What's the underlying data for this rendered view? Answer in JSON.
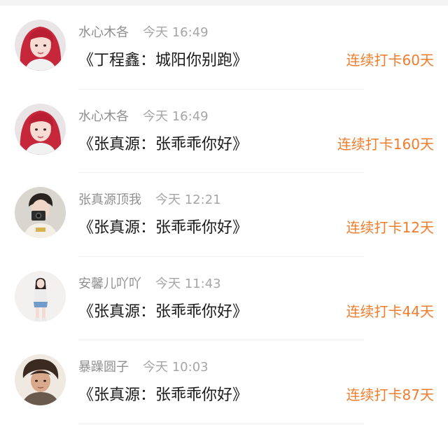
{
  "feed": {
    "items": [
      {
        "username": "水心木各",
        "time": "今天 16:49",
        "title": "《丁程鑫：城阳你别跑》",
        "streak": "连续打卡60天",
        "avatar_icon": "red-hair-avatar-icon"
      },
      {
        "username": "水心木各",
        "time": "今天 16:49",
        "title": "《张真源：张乖乖你好》",
        "streak": "连续打卡160天",
        "avatar_icon": "red-hair-avatar-icon"
      },
      {
        "username": "张真源顶我",
        "time": "今天 12:21",
        "title": "《张真源：张乖乖你好》",
        "streak": "连续打卡12天",
        "avatar_icon": "camera-boy-avatar-icon"
      },
      {
        "username": "安馨儿吖吖",
        "time": "今天 11:43",
        "title": "《张真源：张乖乖你好》",
        "streak": "连续打卡44天",
        "avatar_icon": "girl-standing-avatar-icon"
      },
      {
        "username": "暴躁圆子",
        "time": "今天 10:03",
        "title": "《张真源：张乖乖你好》",
        "streak": "连续打卡87天",
        "avatar_icon": "illustrated-boy-avatar-icon"
      }
    ]
  },
  "colors": {
    "streak": "#f07c2c",
    "meta": "#8f8f8f",
    "title": "#1a1a1a"
  }
}
